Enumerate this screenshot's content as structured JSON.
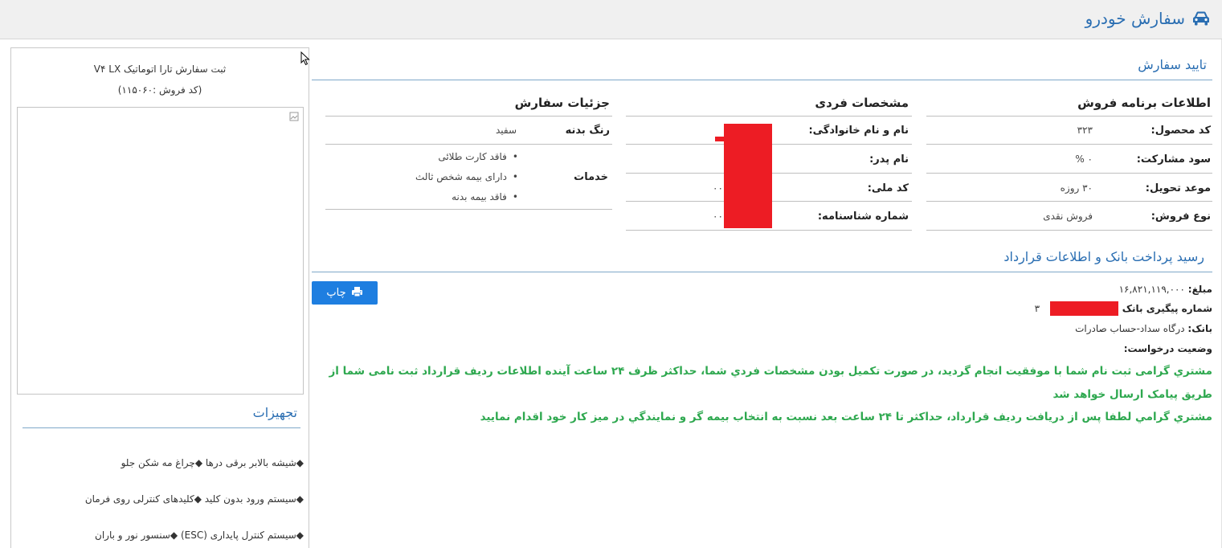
{
  "header": {
    "title": "سفارش خودرو",
    "icon": "car-icon"
  },
  "sidebar": {
    "title": "ثبت سفارش تارا اتوماتیک V۴ LX",
    "sale_code": "(کد فروش :۱۱۵۰۶۰)",
    "image_icon": "broken-image-icon",
    "equipment_title": "تجهیزات",
    "equipment_rows": [
      "◆شیشه بالابر برقی درها  ◆چراغ مه شکن جلو",
      "◆سیستم ورود بدون کلید  ◆کلیدهای کنترلی روی فرمان",
      "◆سیستم کنترل پایداری (ESC)  ◆سنسور نور و باران"
    ]
  },
  "confirm": {
    "title": "تایید سفارش",
    "sales_program": {
      "header": "اطلاعات برنامه فروش",
      "rows": [
        {
          "label": "کد محصول:",
          "value": "۳۲۳"
        },
        {
          "label": "سود مشارکت:",
          "value": "۰ %"
        },
        {
          "label": "موعد تحویل:",
          "value": "۳۰ روزه"
        },
        {
          "label": "نوع فروش:",
          "value": "فروش نقدی"
        }
      ]
    },
    "personal": {
      "header": "مشخصات فردی",
      "rows": [
        {
          "label": "نام و نام خانوادگی:",
          "value": ""
        },
        {
          "label": "نام پدر:",
          "value": ""
        },
        {
          "label": "کد ملی:",
          "value": "۰۰"
        },
        {
          "label": "شماره شناسنامه:",
          "value": "۰۰"
        }
      ]
    },
    "order_details": {
      "header": "جزئیات سفارش",
      "color_label": "رنگ بدنه",
      "color_value": "سفید",
      "services_label": "خدمات",
      "services": [
        "فاقد کارت طلائی",
        "دارای بیمه شخص ثالث",
        "فاقد بیمه بدنه"
      ]
    }
  },
  "receipt": {
    "title": "رسید پرداخت بانک و اطلاعات قرارداد",
    "print_label": "چاپ",
    "print_icon": "printer-icon",
    "amount_label": "مبلغ:",
    "amount_value": "۱۶,۸۲۱,۱۱۹,۰۰۰",
    "tracking_label": "شماره پیگیری بانک :",
    "tracking_value": "۳",
    "bank_label": "بانک:",
    "bank_value": "درگاه سداد-حساب صادرات",
    "status_label": "وضعیت درخواست:",
    "message1": "مشتري گرامی ثبت نام شما با موفقیت انجام گردید، در صورت تکمیل بودن مشخصات فردي شما، حداکثر ظرف ۲۴ ساعت آینده اطلاعات ردیف قرارداد ثبت نامی شما از طریق پیامک ارسال خواهد شد",
    "message2": "مشتري گرامي لطفا پس از دريافت رديف قرارداد، حداکثر تا ۲۴ ساعت بعد نسبت به انتخاب بيمه گر و نمايندگي در ميز کار خود اقدام نماييد"
  },
  "colors": {
    "accent": "#2a6eb2",
    "success": "#2ea84f",
    "redaction": "#ed1c24",
    "button": "#1e7ee0"
  }
}
